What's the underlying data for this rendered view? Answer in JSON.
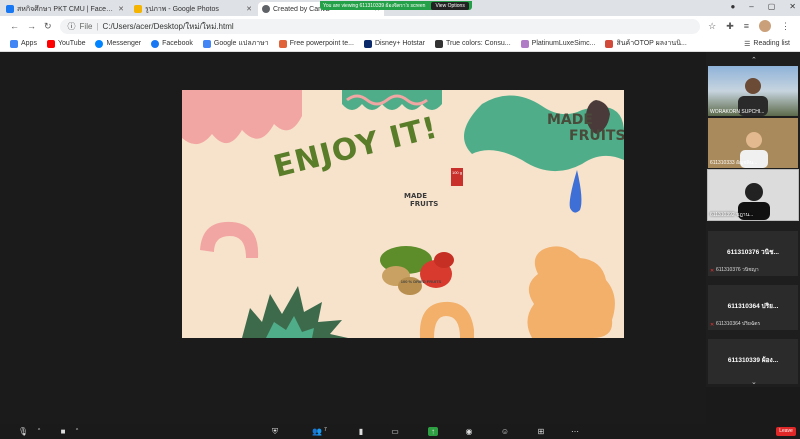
{
  "browser": {
    "tabs": [
      {
        "label": "สหกิจศึกษา PKT CMU | Facebook",
        "icon_color": "#1877f2",
        "active": false
      },
      {
        "label": "รูปภาพ - Google Photos",
        "icon_color": "#f4b400",
        "active": false
      },
      {
        "label": "Created by Canva",
        "icon_color": "#5f6368",
        "active": true
      }
    ],
    "new_tab": "+",
    "share_banner": {
      "text": "You are viewing 611310339 ผ้องจิตรา's screen",
      "options": "View Options"
    },
    "address": {
      "label": "File",
      "url": "C:/Users/acer/Desktop/ใหม่/ใหม่.html"
    },
    "bookmarks": [
      {
        "label": "Apps",
        "color": "#4285f4"
      },
      {
        "label": "YouTube",
        "color": "#ff0000"
      },
      {
        "label": "Messenger",
        "color": "#0084ff"
      },
      {
        "label": "Facebook",
        "color": "#1877f2"
      },
      {
        "label": "Google แปลภาษา",
        "color": "#4285f4"
      },
      {
        "label": "Free powerpoint te...",
        "color": "#e0633a"
      },
      {
        "label": "Disney+ Hotstar",
        "color": "#0a2a6b"
      },
      {
        "label": "True colors: Consu...",
        "color": "#333333"
      },
      {
        "label": "PlatinumLuxeSimc...",
        "color": "#b07cc6"
      },
      {
        "label": "สินค้าOTOP ผลงานนิ...",
        "color": "#d24a3a"
      }
    ],
    "reading_list": "Reading list"
  },
  "slide": {
    "enjoy_text": "ENJOY IT!",
    "brand_line1": "MADE",
    "brand_line2": "FRUITS",
    "pack": {
      "logo_line1": "MADE",
      "logo_line2": "FRUITS",
      "weight": "100 g",
      "tagline": "100 % DRIED FRUITS"
    },
    "colors": {
      "background": "#f7e3cc",
      "green": "#4fae89",
      "pink": "#f2a6a3",
      "orange": "#f2b06a",
      "blue": "#3e6fd6",
      "darkgreen": "#3e6a4c"
    }
  },
  "participants": {
    "videos": [
      {
        "name": "WORAKORN SUPCHI..."
      },
      {
        "name": "611310333 อัญชลิน..."
      },
      {
        "name": "611310392 ชฎาน..."
      }
    ],
    "tiles": [
      {
        "big": "611310376 วนิช...",
        "small": "611310376 วนิชญา"
      },
      {
        "big": "611310364 ปริย...",
        "small": "611310364 ปริยฉัตร"
      },
      {
        "big": "611310339 ผ้อง...",
        "small": ""
      }
    ]
  },
  "toolbar": {
    "participants_count": "7",
    "leave": "Leave"
  }
}
